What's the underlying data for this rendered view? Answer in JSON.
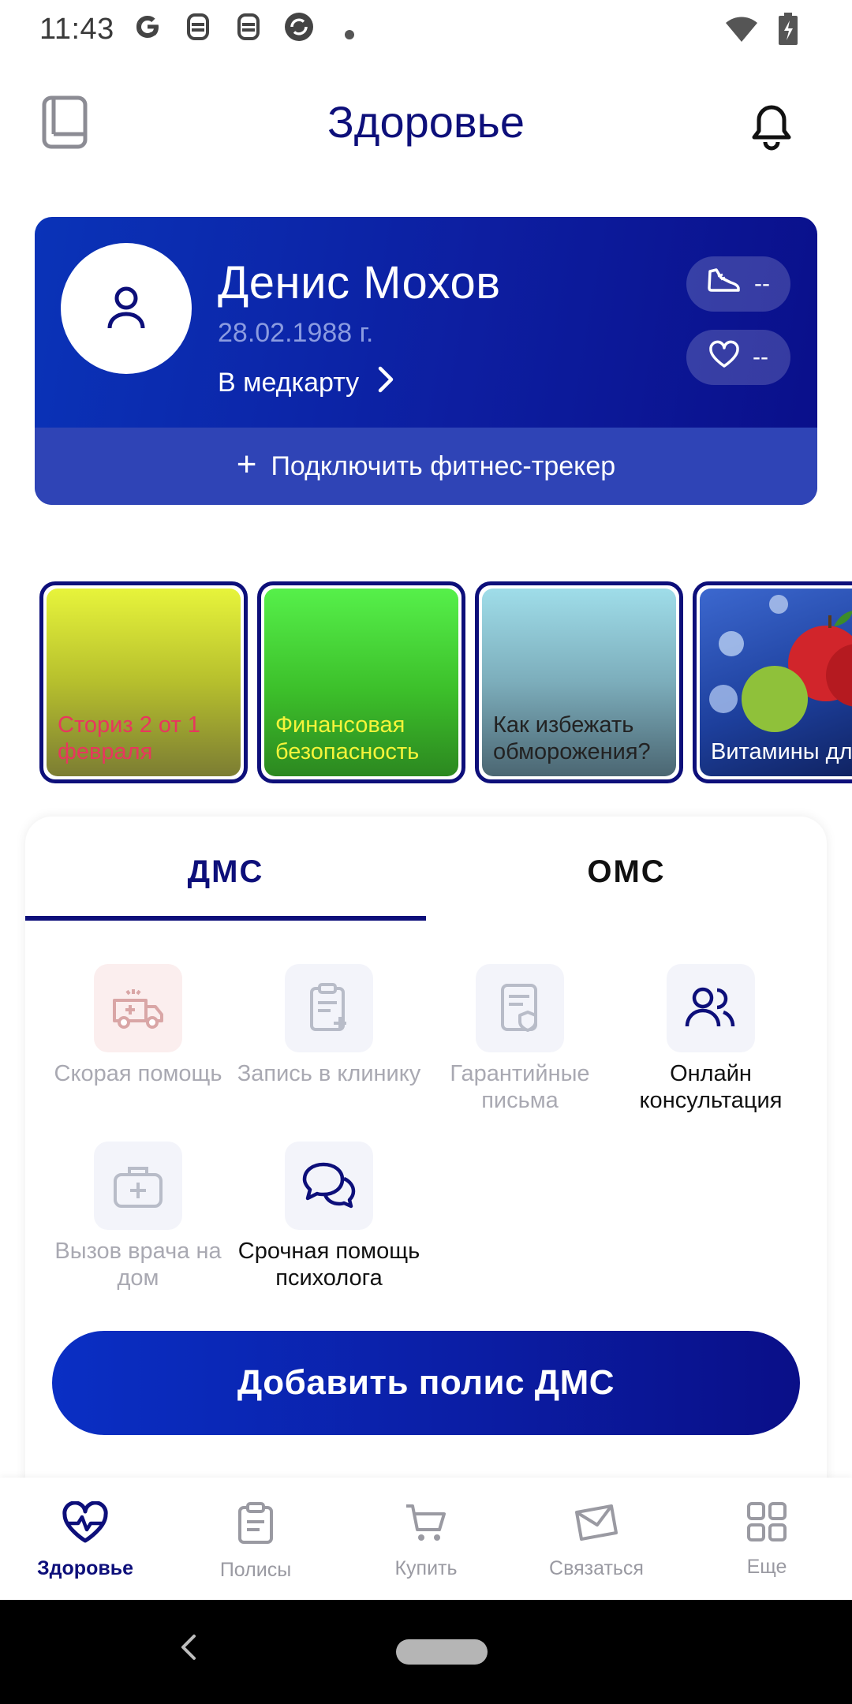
{
  "status_bar": {
    "time": "11:43",
    "left_icons": [
      "google-g-icon",
      "notification-icon",
      "notification-icon",
      "sync-icon",
      "dot-icon"
    ],
    "right_icons": [
      "wifi-icon",
      "battery-charging-icon"
    ]
  },
  "header": {
    "title": "Здоровье",
    "left_icon": "medcard-icon",
    "right_icon": "bell-icon"
  },
  "profile": {
    "name": "Денис Мохов",
    "dob": "28.02.1988 г.",
    "medcard_link": "В медкарту",
    "steps_value": "--",
    "pulse_value": "--",
    "tracker_cta": "Подключить фитнес-трекер"
  },
  "stories": [
    {
      "title": "Сториз 2 от 1 февраля"
    },
    {
      "title": "Финансовая безопасность"
    },
    {
      "title": "Как избежать обморожения?"
    },
    {
      "title": "Витамины для иммунитета"
    }
  ],
  "tabs": {
    "dms": "ДМС",
    "oms": "ОМС",
    "active": "dms"
  },
  "services": [
    {
      "label": "Скорая помощь",
      "enabled": false
    },
    {
      "label": "Запись в клинику",
      "enabled": false
    },
    {
      "label": "Гарантийные письма",
      "enabled": false
    },
    {
      "label": "Онлайн консультация",
      "enabled": true
    },
    {
      "label": "Вызов врача на дом",
      "enabled": false
    },
    {
      "label": "Срочная помощь психолога",
      "enabled": true
    }
  ],
  "add_policy_button": "Добавить полис ДМС",
  "bottom_nav": [
    {
      "label": "Здоровье",
      "active": true
    },
    {
      "label": "Полисы",
      "active": false
    },
    {
      "label": "Купить",
      "active": false
    },
    {
      "label": "Связаться",
      "active": false
    },
    {
      "label": "Еще",
      "active": false
    }
  ],
  "colors": {
    "brand_navy": "#0d0f7a",
    "card_blue": "#0a33b8",
    "disabled_text": "#a9a9b2"
  }
}
